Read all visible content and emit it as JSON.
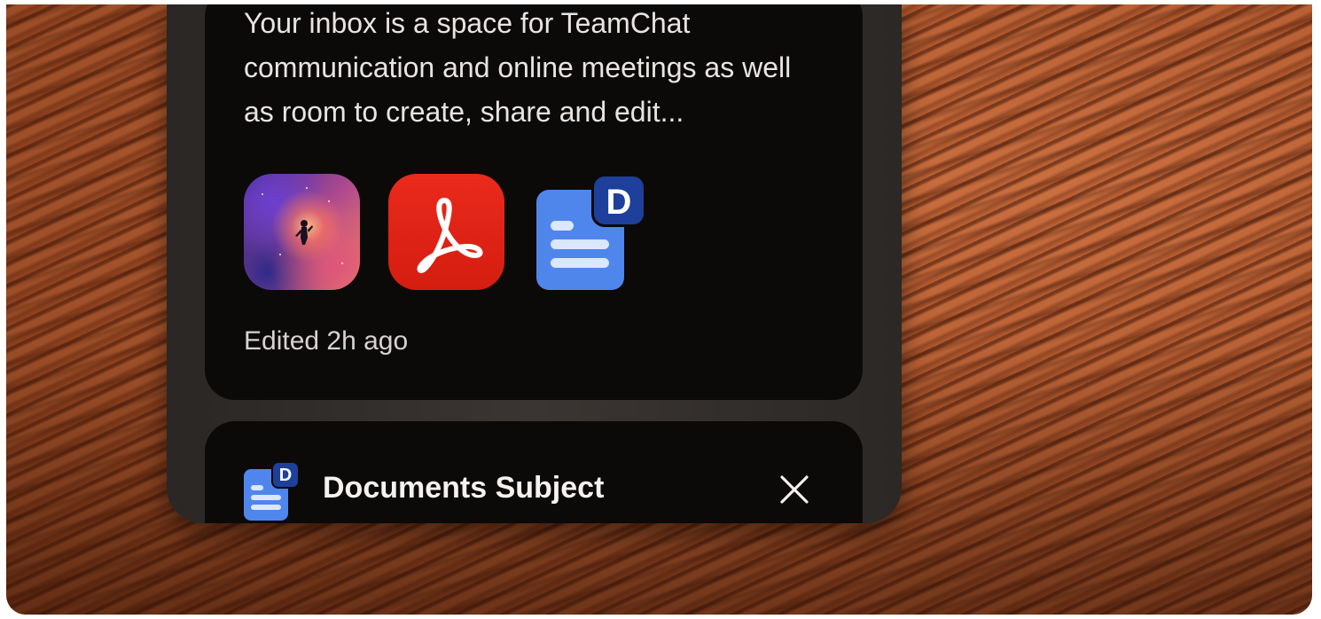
{
  "message_card": {
    "preview_text": "Your inbox is a space for TeamChat communication and online meetings as well as room to create, share and edit...",
    "attachments": [
      {
        "icon": "photo-thumbnail-icon"
      },
      {
        "icon": "pdf-file-icon"
      },
      {
        "icon": "document-file-icon",
        "badge": "D"
      }
    ],
    "edited_label": "Edited 2h ago"
  },
  "document_card": {
    "icon": "document-file-icon",
    "badge": "D",
    "title": "Documents Subject",
    "close_icon": "close-icon"
  },
  "colors": {
    "card_bg": "#0c0909",
    "pdf_red": "#e0261a",
    "doc_blue": "#4f86ec",
    "doc_badge": "#1e3f9a"
  }
}
